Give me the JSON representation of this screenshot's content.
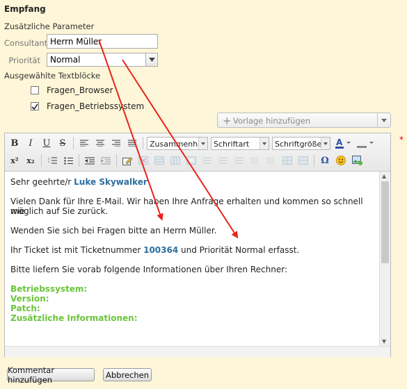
{
  "section": {
    "title": "Empfang"
  },
  "params": {
    "title": "Zusätzliche Parameter",
    "consultant_label": "Consultant",
    "consultant_value": "Herrn Müller",
    "priority_label": "Priorität",
    "priority_value": "Normal"
  },
  "textblocks": {
    "title": "Ausgewählte Textblöcke",
    "items": [
      {
        "label": "Fragen_Browser",
        "checked": false
      },
      {
        "label": "Fragen_Betriebssystem",
        "checked": true
      }
    ]
  },
  "template": {
    "add_label": "Vorlage hinzufügen"
  },
  "toolbar": {
    "row1": [
      "bold-icon",
      "italic-icon",
      "underline-icon",
      "strikethrough-icon",
      "align-left-icon",
      "align-center-icon",
      "align-right-icon",
      "justify-icon"
    ],
    "format_combo": "Zusammenhäng",
    "font_combo": "Schriftart",
    "size_combo": "Schriftgröße",
    "row2": [
      "superscript-icon",
      "subscript-icon",
      "numbered-list-icon",
      "bullet-list-icon",
      "outdent-icon",
      "indent-icon",
      "edit-icon",
      "table-icons",
      "omega-icon",
      "smiley-icon",
      "image-icon"
    ]
  },
  "editor": {
    "greeting_prefix": "Sehr geehrte/r ",
    "greeting_name": "Luke Skywalker",
    "para1_line1": "Vielen Dank für Ihre E-Mail. Wir haben Ihre Anfrage erhalten und kommen so schnell wie",
    "para1_line2": "möglich auf Sie zurück.",
    "para2": "Wenden Sie sich bei Fragen bitte an Herrn Müller.",
    "para3_prefix": "Ihr Ticket ist mit Ticketnummer ",
    "ticket_number": "100364",
    "para3_suffix": " und Priorität Normal erfasst.",
    "para4": "Bitte liefern Sie vorab folgende Informationen über Ihren Rechner:",
    "fields": [
      "Betriebssystem:",
      "Version:",
      "Patch:",
      "Zusätzliche Informationen:"
    ]
  },
  "buttons": {
    "add_comment": "Kommentar hinzufügen",
    "cancel": "Abbrechen"
  },
  "colors": {
    "background": "#fdf6d8",
    "highlight": "#2a6ea0",
    "green": "#6ac53a",
    "arrow": "#e8231b",
    "required": "#dd0000"
  },
  "required_marker": "*"
}
